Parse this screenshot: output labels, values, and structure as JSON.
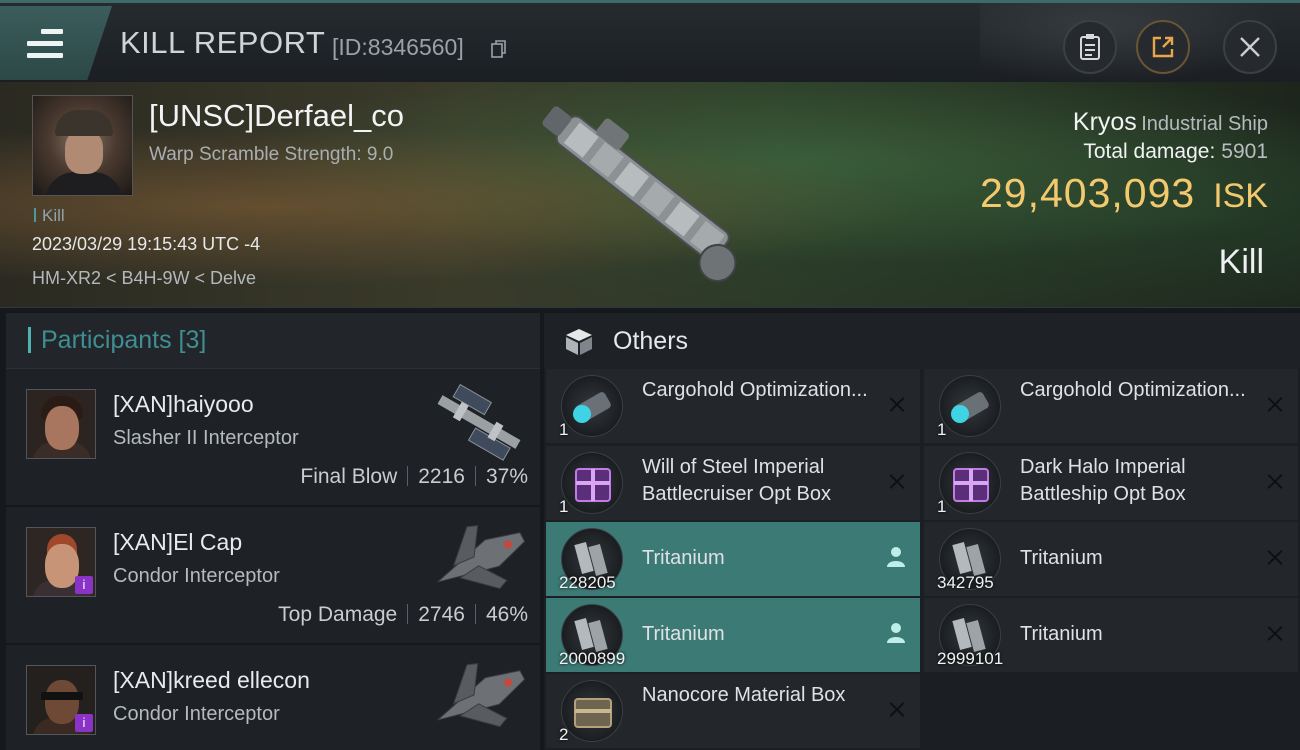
{
  "header": {
    "title": "KILL REPORT",
    "report_id": "[ID:8346560]",
    "icons": [
      "menu-icon",
      "copy-icon",
      "clipboard-icon",
      "share-icon",
      "close-icon"
    ]
  },
  "victim": {
    "name": "[UNSC]Derfael_co",
    "warp_scramble": "Warp Scramble Strength: 9.0",
    "kill_tag": "Kill",
    "datetime": "2023/03/29 19:15:43 UTC -4",
    "location": "HM-XR2 < B4H-9W < Delve"
  },
  "ship": {
    "name": "Kryos",
    "class": "Industrial Ship",
    "total_damage_label": "Total damage:",
    "total_damage": "5901",
    "isk_value": "29,403,093",
    "isk_unit": "ISK",
    "result": "Kill"
  },
  "participants": {
    "title": "Participants [3]",
    "rows": [
      {
        "name": "[XAN]haiyooo",
        "ship": "Slasher II Interceptor",
        "role": "Final Blow",
        "damage": "2216",
        "percent": "37%",
        "badge": ""
      },
      {
        "name": "[XAN]El Cap",
        "ship": "Condor Interceptor",
        "role": "Top Damage",
        "damage": "2746",
        "percent": "46%",
        "badge": "i"
      },
      {
        "name": "[XAN]kreed ellecon",
        "ship": "Condor Interceptor",
        "role": "",
        "damage": "",
        "percent": "",
        "badge": "i"
      }
    ]
  },
  "others": {
    "title": "Others",
    "items": [
      {
        "name": "Cargohold Optimization...",
        "qty": "1",
        "icon": "cargohold-module-icon",
        "highlight": false
      },
      {
        "name": "Cargohold Optimization...",
        "qty": "1",
        "icon": "cargohold-module-icon",
        "highlight": false
      },
      {
        "name": "Will of Steel Imperial Battlecruiser Opt Box",
        "qty": "1",
        "icon": "purple-crate-icon",
        "highlight": false
      },
      {
        "name": "Dark Halo Imperial Battleship Opt Box",
        "qty": "1",
        "icon": "purple-crate-icon",
        "highlight": false
      },
      {
        "name": "Tritanium",
        "qty": "228205",
        "icon": "tritanium-icon",
        "highlight": true
      },
      {
        "name": "Tritanium",
        "qty": "342795",
        "icon": "tritanium-icon",
        "highlight": false
      },
      {
        "name": "Tritanium",
        "qty": "2000899",
        "icon": "tritanium-icon",
        "highlight": true
      },
      {
        "name": "Tritanium",
        "qty": "2999101",
        "icon": "tritanium-icon",
        "highlight": false
      },
      {
        "name": "Nanocore Material Box",
        "qty": "2",
        "icon": "nanocore-box-icon",
        "highlight": false
      }
    ]
  },
  "colors": {
    "accent_teal": "#3c7a76",
    "isk_gold": "#f3c96e",
    "badge_purple": "#8a33c7"
  }
}
